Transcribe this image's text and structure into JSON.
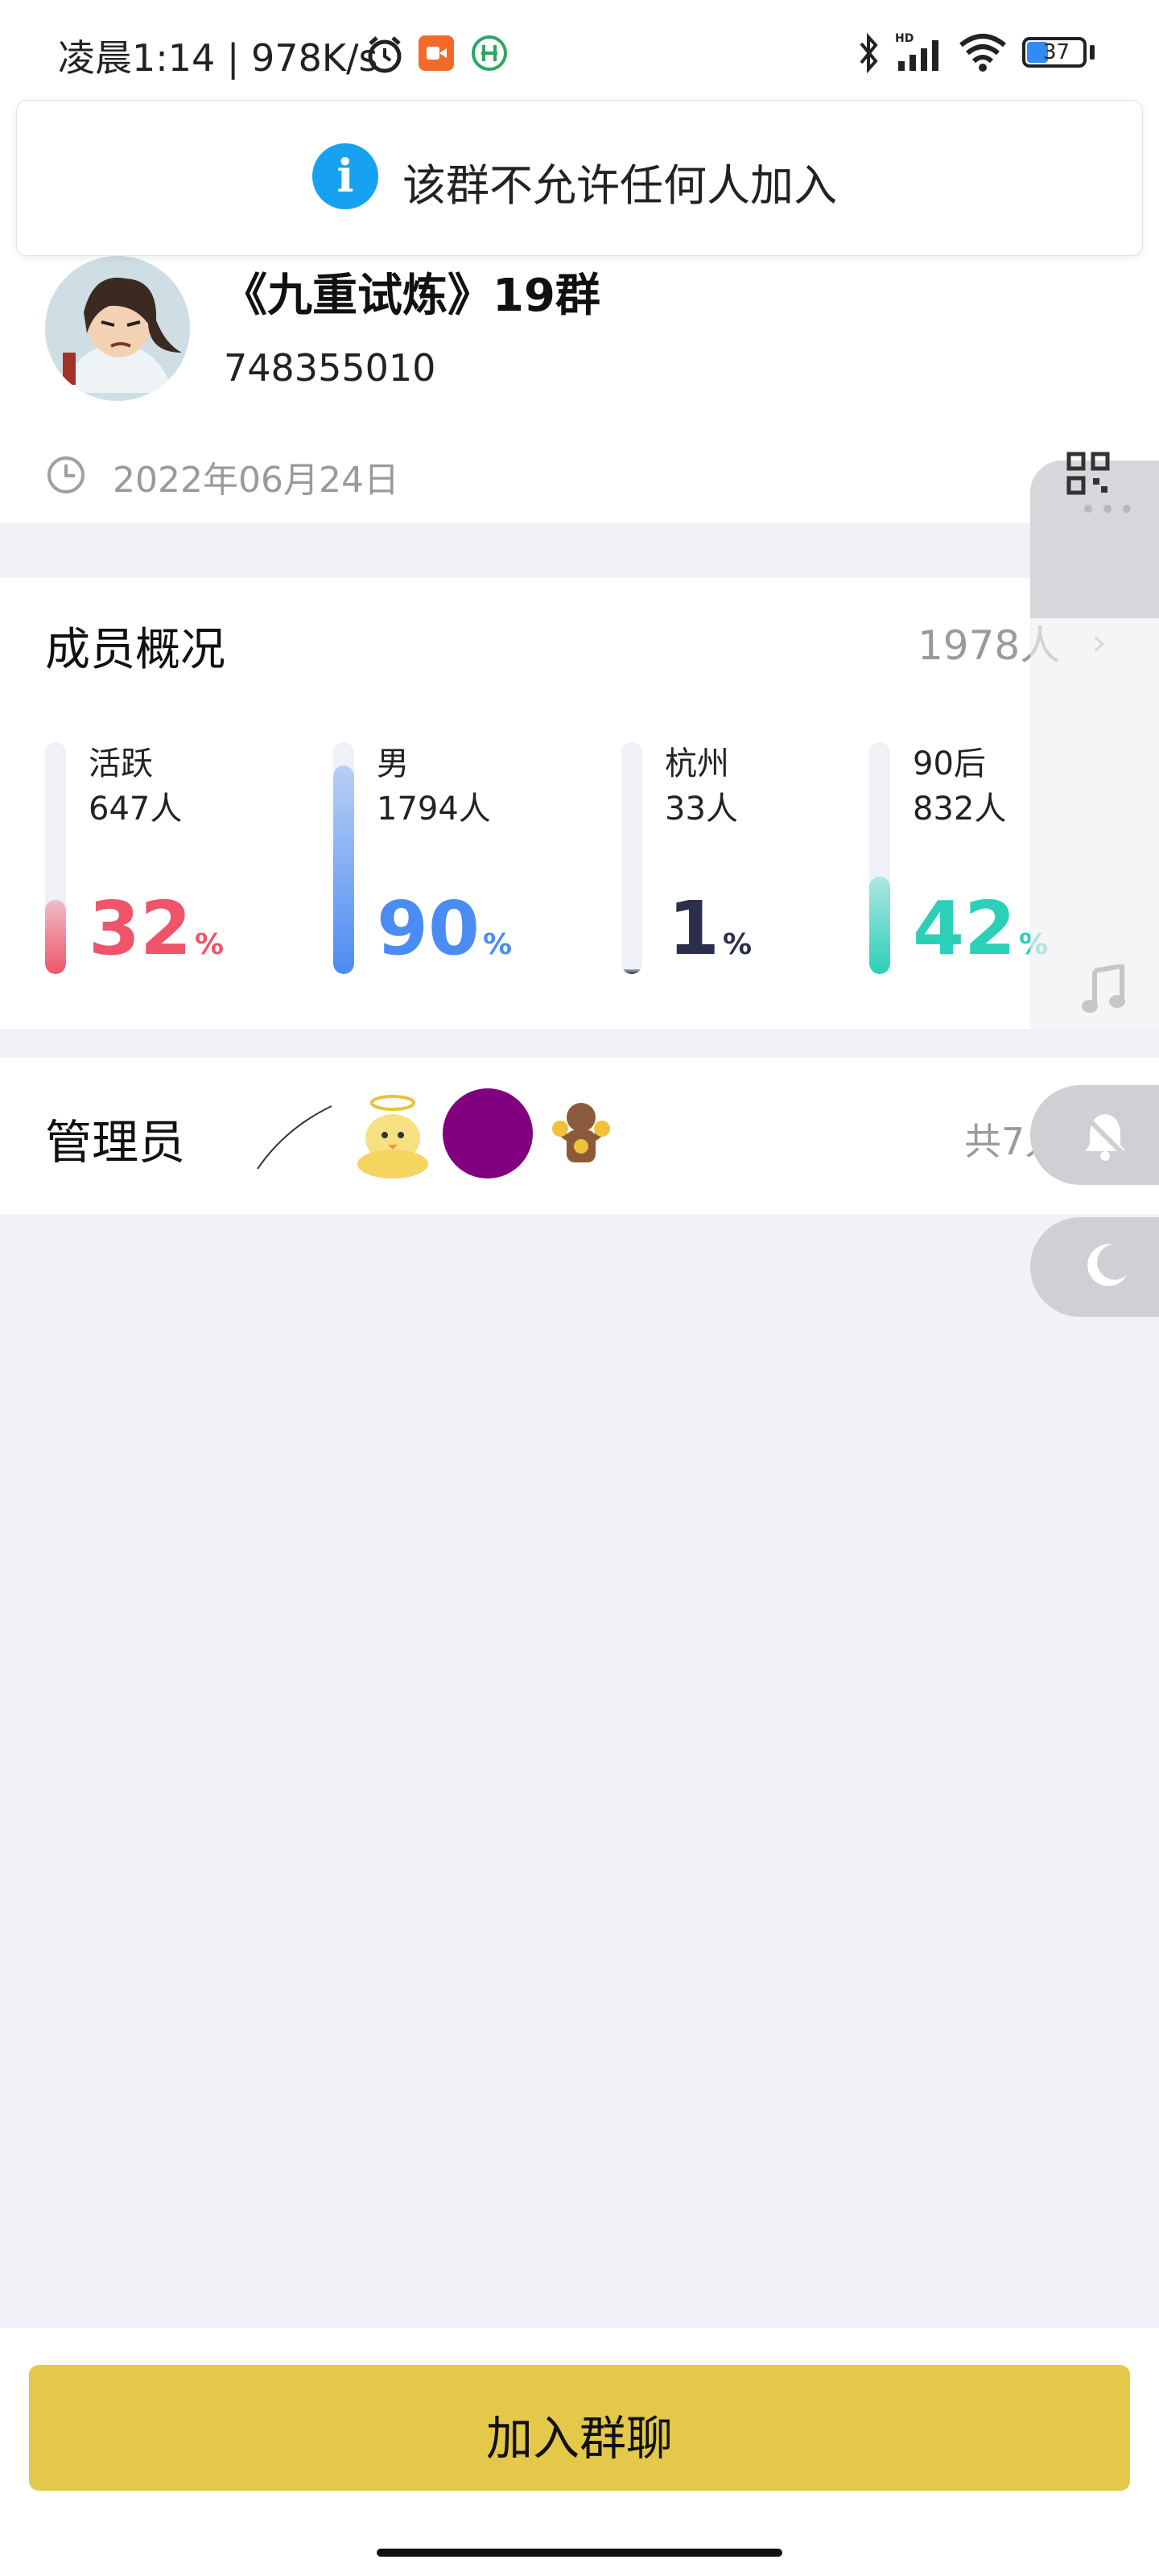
{
  "status_bar": {
    "time_speed": "凌晨1:14 | 978K/s",
    "battery": "37"
  },
  "toast": {
    "message": "该群不允许任何人加入"
  },
  "group": {
    "name": "《九重试炼》19群",
    "id": "748355010",
    "created_date": "2022年06月24日"
  },
  "members": {
    "title": "成员概况",
    "count": "1978人",
    "stats": [
      {
        "label": "活跃",
        "count": "647人",
        "percent": "32",
        "fill": 0.32,
        "color": "#f0546a"
      },
      {
        "label": "男",
        "count": "1794人",
        "percent": "90",
        "fill": 0.9,
        "color": "#4b8cf2"
      },
      {
        "label": "杭州",
        "count": "33人",
        "percent": "1",
        "fill": 0.01,
        "color": "#2b2f4b"
      },
      {
        "label": "90后",
        "count": "832人",
        "percent": "42",
        "fill": 0.42,
        "color": "#2cd0b8"
      }
    ],
    "percent_unit": "%"
  },
  "admins": {
    "title": "管理员",
    "total": "共7人"
  },
  "join_button": {
    "label": "加入群聊"
  }
}
